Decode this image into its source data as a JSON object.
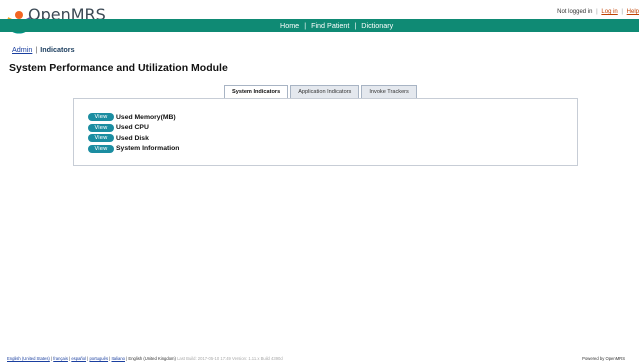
{
  "header": {
    "brand": "OpenMRS",
    "user_status": "Not logged in",
    "login_link": "Log in",
    "help_link": "Help"
  },
  "nav": {
    "items": [
      "Home",
      "Find Patient",
      "Dictionary"
    ],
    "separator": "|"
  },
  "breadcrumb": {
    "parent": "Admin",
    "divider": "|",
    "current": "Indicators"
  },
  "page": {
    "title": "System Performance and Utilization Module"
  },
  "tabs": [
    {
      "label": "System Indicators",
      "active": true
    },
    {
      "label": "Application Indicators",
      "active": false
    },
    {
      "label": "Invoke Trackers",
      "active": false
    }
  ],
  "indicators": {
    "button_label": "View",
    "items": [
      "Used Memory(MB)",
      "Used CPU",
      "Used Disk",
      "System Information"
    ]
  },
  "footer": {
    "languages": [
      "English (United States)",
      "français",
      "español",
      "português",
      "Italiano"
    ],
    "current_language": "English (United Kingdom)",
    "build_info": "Last Build: 2017-05-10 17:49   Version: 1.11.x Build 4390d",
    "powered_by": "Powered by OpenMRS"
  },
  "colors": {
    "nav_bg": "#0f8a74",
    "button_bg": "#1b8da1",
    "link": "#1a3fa0",
    "logo_orange": "#f26522",
    "logo_blue": "#5b57a6"
  }
}
